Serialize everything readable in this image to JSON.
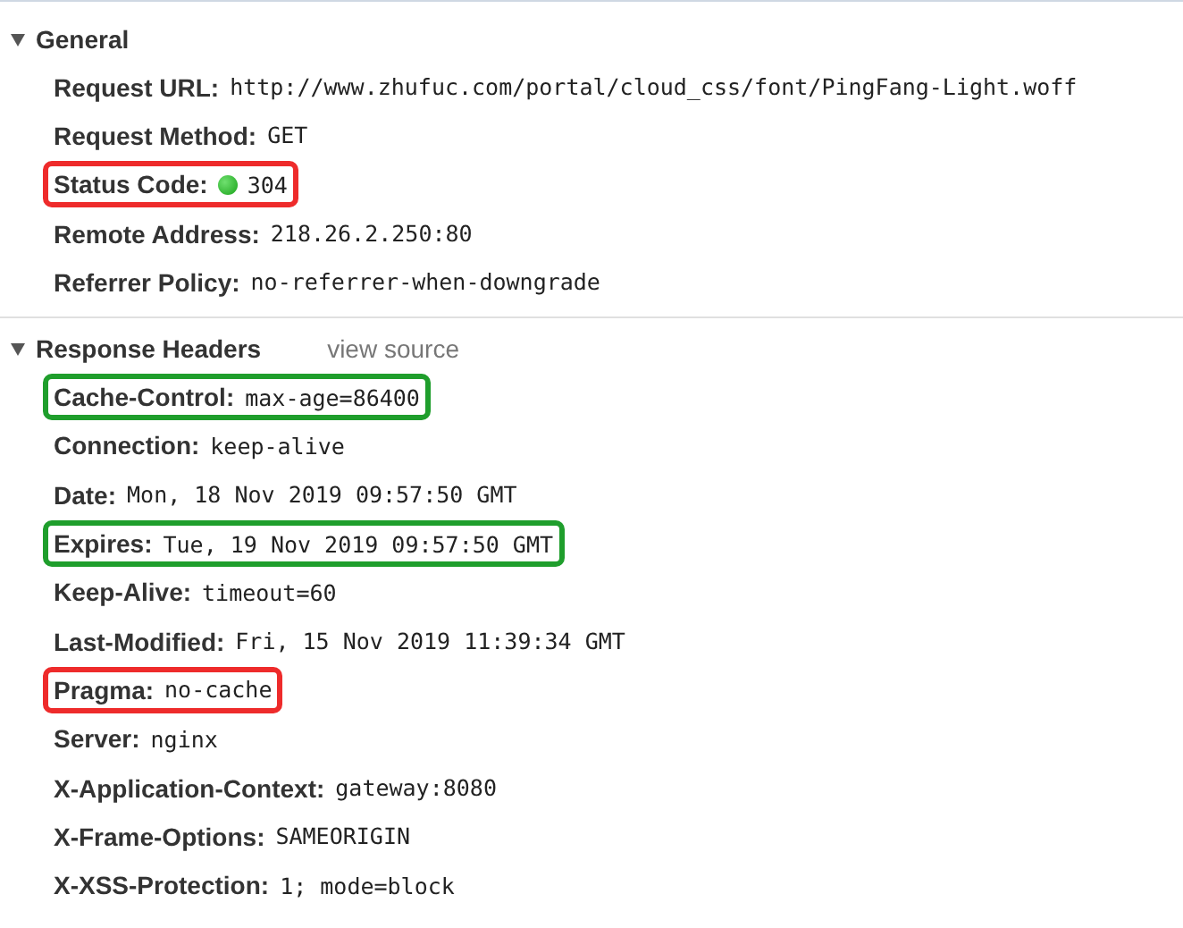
{
  "sections": [
    {
      "title": "General",
      "expanded": true,
      "rows": [
        {
          "kind": "text",
          "name": "Request URL:",
          "value": "http://www.zhufuc.com/portal/cloud_css/font/PingFang-Light.woff"
        },
        {
          "kind": "text",
          "name": "Request Method:",
          "value": "GET"
        },
        {
          "kind": "status",
          "name": "Status Code:",
          "value": "304",
          "color": "#ee2b2b"
        },
        {
          "kind": "text",
          "name": "Remote Address:",
          "value": "218.26.2.250:80"
        },
        {
          "kind": "text",
          "name": "Referrer Policy:",
          "value": "no-referrer-when-downgrade"
        }
      ]
    },
    {
      "title": "Response Headers",
      "expanded": true,
      "link": "view source",
      "rows": [
        {
          "kind": "text",
          "name": "Cache-Control:",
          "value": "max-age=86400",
          "color": "#1f9e2c"
        },
        {
          "kind": "text",
          "name": "Connection:",
          "value": "keep-alive"
        },
        {
          "kind": "text",
          "name": "Date:",
          "value": "Mon, 18 Nov 2019 09:57:50 GMT"
        },
        {
          "kind": "text",
          "name": "Expires:",
          "value": "Tue, 19 Nov 2019 09:57:50 GMT",
          "color": "#1f9e2c"
        },
        {
          "kind": "text",
          "name": "Keep-Alive:",
          "value": "timeout=60"
        },
        {
          "kind": "text",
          "name": "Last-Modified:",
          "value": "Fri, 15 Nov 2019 11:39:34 GMT"
        },
        {
          "kind": "text",
          "name": "Pragma:",
          "value": "no-cache",
          "color": "#ee2b2b"
        },
        {
          "kind": "text",
          "name": "Server:",
          "value": "nginx"
        },
        {
          "kind": "text",
          "name": "X-Application-Context:",
          "value": "gateway:8080"
        },
        {
          "kind": "text",
          "name": "X-Frame-Options:",
          "value": "SAMEORIGIN"
        },
        {
          "kind": "text",
          "name": "X-XSS-Protection:",
          "value": "1; mode=block"
        }
      ]
    }
  ]
}
